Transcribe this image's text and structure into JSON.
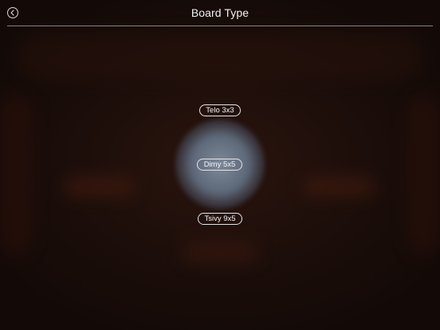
{
  "header": {
    "title": "Board Type",
    "back_icon": "chevron-left-icon"
  },
  "options": [
    {
      "label": "Telo 3x3",
      "selected": false
    },
    {
      "label": "Dimy 5x5",
      "selected": true
    },
    {
      "label": "Tsivy 9x5",
      "selected": false
    }
  ],
  "colors": {
    "background": "#1c0e0a",
    "text": "#f2f2f2",
    "selection_glow": "#7d8a9a",
    "divider": "#8e807a"
  }
}
